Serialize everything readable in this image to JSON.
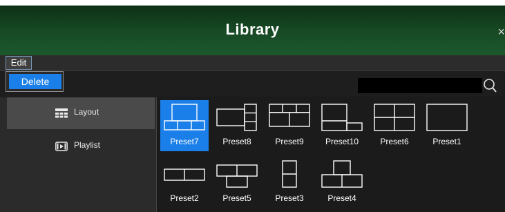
{
  "window": {
    "title": "Library",
    "close_symbol": "×"
  },
  "menu": {
    "edit_label": "Edit",
    "delete_label": "Delete"
  },
  "search": {
    "value": "",
    "placeholder": ""
  },
  "sidebar": {
    "items": [
      {
        "label": "Layout",
        "icon": "layout-grid-icon",
        "active": true
      },
      {
        "label": "Playlist",
        "icon": "playlist-film-icon",
        "active": false
      }
    ]
  },
  "presets": [
    {
      "label": "Preset7",
      "selected": true
    },
    {
      "label": "Preset8",
      "selected": false
    },
    {
      "label": "Preset9",
      "selected": false
    },
    {
      "label": "Preset10",
      "selected": false
    },
    {
      "label": "Preset6",
      "selected": false
    },
    {
      "label": "Preset1",
      "selected": false
    },
    {
      "label": "Preset2",
      "selected": false
    },
    {
      "label": "Preset5",
      "selected": false
    },
    {
      "label": "Preset3",
      "selected": false
    },
    {
      "label": "Preset4",
      "selected": false
    }
  ],
  "colors": {
    "accent": "#1a7fe8",
    "title_bar": "#174a25",
    "background": "#1b1b1b"
  }
}
